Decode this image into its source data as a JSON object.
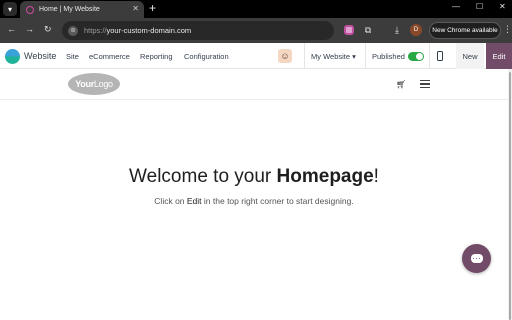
{
  "browser": {
    "tab_title": "Home | My Website",
    "tab_close": "✕",
    "new_tab": "+",
    "window_controls": {
      "minimize": "—",
      "maximize": "☐",
      "close": "✕"
    },
    "url_protocol": "https://",
    "url_host": "your-custom-domain.com",
    "profile_initial": "D",
    "update_label": "New Chrome available",
    "menu": "⋮"
  },
  "odoo_nav": {
    "app_name": "Website",
    "menu": [
      "Site",
      "eCommerce",
      "Reporting",
      "Configuration"
    ],
    "website_select": "My Website",
    "published_label": "Published",
    "published": true,
    "new_label": "New",
    "edit_label": "Edit"
  },
  "site_header": {
    "logo_text_a": "Your",
    "logo_text_b": "Logo"
  },
  "hero": {
    "title_prefix": "Welcome to your ",
    "title_bold": "Homepage",
    "title_suffix": "!",
    "sub_prefix": "Click on ",
    "sub_edit": "Edit",
    "sub_suffix": " in the top right corner to start designing."
  },
  "colors": {
    "odoo_purple": "#714b67",
    "toggle_green": "#28a745",
    "chrome_dark": "#3c3c3c"
  },
  "icons": {
    "tab_menu": "chevron-down-icon",
    "back": "arrow-left-icon",
    "forward": "arrow-right-icon",
    "reload": "reload-icon",
    "site_info": "site-info-icon",
    "extension_pink": "extension-icon",
    "puzzle": "puzzle-icon",
    "download": "download-icon",
    "cart": "cart-icon",
    "hamburger": "hamburger-icon",
    "chat": "chat-icon",
    "mobile": "mobile-preview-icon"
  }
}
